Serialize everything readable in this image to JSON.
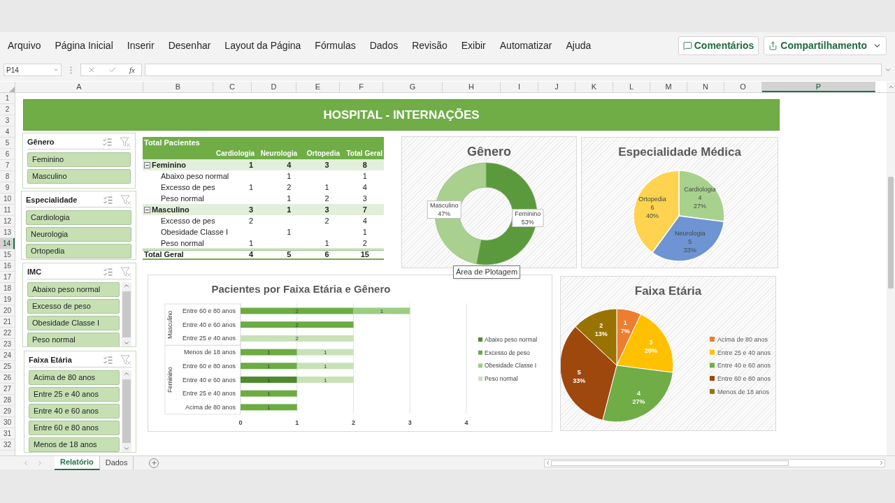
{
  "menu": [
    {
      "label": "Arquivo"
    },
    {
      "label": "Página Inicial"
    },
    {
      "label": "Inserir"
    },
    {
      "label": "Desenhar"
    },
    {
      "label": "Layout da Página"
    },
    {
      "label": "Fórmulas"
    },
    {
      "label": "Dados"
    },
    {
      "label": "Revisão"
    },
    {
      "label": "Exibir"
    },
    {
      "label": "Automatizar"
    },
    {
      "label": "Ajuda"
    }
  ],
  "actions": {
    "comments": "Comentários",
    "share": "Compartilhamento"
  },
  "formula_bar": {
    "name_box": "P14",
    "function_label": "fx"
  },
  "columns": [
    {
      "label": "A",
      "selected": false
    },
    {
      "label": "B",
      "selected": false
    },
    {
      "label": "C",
      "selected": false
    },
    {
      "label": "D",
      "selected": false
    },
    {
      "label": "E",
      "selected": false
    },
    {
      "label": "F",
      "selected": false
    },
    {
      "label": "G",
      "selected": false
    },
    {
      "label": "H",
      "selected": false
    },
    {
      "label": "I",
      "selected": false
    },
    {
      "label": "J",
      "selected": false
    },
    {
      "label": "K",
      "selected": false
    },
    {
      "label": "L",
      "selected": false
    },
    {
      "label": "M",
      "selected": false
    },
    {
      "label": "N",
      "selected": false
    },
    {
      "label": "O",
      "selected": false
    },
    {
      "label": "P",
      "selected": true
    }
  ],
  "rows": [
    {
      "label": "1",
      "selected": false
    },
    {
      "label": "2",
      "selected": false
    },
    {
      "label": "3",
      "selected": false
    },
    {
      "label": "4",
      "selected": false
    },
    {
      "label": "5",
      "selected": false
    },
    {
      "label": "6",
      "selected": false
    },
    {
      "label": "7",
      "selected": false
    },
    {
      "label": "8",
      "selected": false
    },
    {
      "label": "9",
      "selected": false
    },
    {
      "label": "10",
      "selected": false
    },
    {
      "label": "11",
      "selected": false
    },
    {
      "label": "12",
      "selected": false
    },
    {
      "label": "13",
      "selected": false
    },
    {
      "label": "14",
      "selected": true
    },
    {
      "label": "15",
      "selected": false
    },
    {
      "label": "16",
      "selected": false
    },
    {
      "label": "17",
      "selected": false
    },
    {
      "label": "18",
      "selected": false
    },
    {
      "label": "19",
      "selected": false
    },
    {
      "label": "20",
      "selected": false
    },
    {
      "label": "21",
      "selected": false
    },
    {
      "label": "22",
      "selected": false
    },
    {
      "label": "23",
      "selected": false
    },
    {
      "label": "24",
      "selected": false
    },
    {
      "label": "25",
      "selected": false
    },
    {
      "label": "26",
      "selected": false
    },
    {
      "label": "27",
      "selected": false
    },
    {
      "label": "28",
      "selected": false
    },
    {
      "label": "29",
      "selected": false
    },
    {
      "label": "30",
      "selected": false
    },
    {
      "label": "31",
      "selected": false
    },
    {
      "label": "32",
      "selected": false
    }
  ],
  "banner": "HOSPITAL - INTERNAÇÕES",
  "slicers": [
    {
      "title": "Gênero",
      "items": [
        {
          "label": "Feminino",
          "selected": true
        },
        {
          "label": "Masculino",
          "selected": true
        }
      ]
    },
    {
      "title": "Especialidade",
      "items": [
        {
          "label": "Cardiologia",
          "selected": true
        },
        {
          "label": "Neurologia",
          "selected": true
        },
        {
          "label": "Ortopedia",
          "selected": true
        }
      ]
    },
    {
      "title": "IMC",
      "items": [
        {
          "label": "Abaixo peso normal",
          "selected": true
        },
        {
          "label": "Excesso de peso",
          "selected": true
        },
        {
          "label": "Obesidade Classe I",
          "selected": true
        },
        {
          "label": "Peso normal",
          "selected": true
        }
      ]
    },
    {
      "title": "Faixa Etária",
      "items": [
        {
          "label": "Acima de 80 anos",
          "selected": true
        },
        {
          "label": "Entre 25 e 40 anos",
          "selected": true
        },
        {
          "label": "Entre 40 e 60 anos",
          "selected": true
        },
        {
          "label": "Entre 60 e 80 anos",
          "selected": true
        },
        {
          "label": "Menos de 18 anos",
          "selected": true
        }
      ]
    }
  ],
  "pivot": {
    "title": "Total Pacientes",
    "columns": [
      "Cardiologia",
      "Neurologia",
      "Ortopedia",
      "Total Geral"
    ],
    "rows": [
      {
        "kind": "group",
        "label": "Feminino",
        "expanded": true,
        "cells": [
          "1",
          "4",
          "3",
          "8"
        ]
      },
      {
        "kind": "item",
        "label": "Abaixo peso normal",
        "cells": [
          null,
          "1",
          null,
          "1"
        ]
      },
      {
        "kind": "item",
        "label": "Excesso de pes",
        "cells": [
          "1",
          "2",
          "1",
          "4"
        ]
      },
      {
        "kind": "item",
        "label": "Peso normal",
        "cells": [
          null,
          "1",
          "2",
          "3"
        ]
      },
      {
        "kind": "group",
        "label": "Masculino",
        "expanded": true,
        "cells": [
          "3",
          "1",
          "3",
          "7"
        ]
      },
      {
        "kind": "item",
        "label": "Excesso de pes",
        "cells": [
          "2",
          null,
          "2",
          "4"
        ]
      },
      {
        "kind": "item",
        "label": "Obesidade Classe I",
        "cells": [
          null,
          "1",
          null,
          "1"
        ]
      },
      {
        "kind": "item",
        "label": "Peso normal",
        "cells": [
          "1",
          null,
          "1",
          "2"
        ]
      },
      {
        "kind": "total",
        "label": "Total Geral",
        "cells": [
          "4",
          "5",
          "6",
          "15"
        ]
      }
    ]
  },
  "gender_chart": {
    "chart_data": {
      "type": "donut",
      "title": "Gênero",
      "categories": [
        "Feminino",
        "Masculino"
      ],
      "values": [
        53,
        47
      ],
      "colors": [
        "#5b9a3c",
        "#a9d08e"
      ],
      "value_labels": [
        "53%",
        "47%"
      ]
    }
  },
  "tooltip": "Área de Plotagem",
  "specialty_chart": {
    "counts": [
      "4",
      "5",
      "6"
    ],
    "chart_data": {
      "type": "pie",
      "title": "Especialidade Médica",
      "categories": [
        "Cardiologia",
        "Neurologia",
        "Ortopedia"
      ],
      "values": [
        27,
        33,
        40
      ],
      "colors": [
        "#a9d18e",
        "#6f94d4",
        "#ffd34f"
      ],
      "value_labels": [
        "27%",
        "33%",
        "40%"
      ]
    }
  },
  "age_gender_chart": {
    "groups": [
      {
        "label": "Masculino"
      },
      {
        "label": "Feminino"
      }
    ],
    "chart_data": {
      "type": "bar",
      "orientation": "horizontal",
      "stacked": true,
      "grid": true,
      "legend": "right",
      "title": "Pacientes por Faixa Etária e Gênero",
      "categories": [
        "Entre 60 e 80 anos",
        "Entre 40 e 60 anos",
        "Entre 25 e 40 anos",
        "Menos de 18 anos",
        "Entre 60 e 80 anos",
        "Entre 40 e 60 anos",
        "Entre 25 e 40 anos",
        "Acima de 80 anos"
      ],
      "xlim": [
        0,
        4
      ],
      "xticks": [
        0,
        1,
        2,
        3,
        4
      ],
      "data_labels": true,
      "series": [
        {
          "name": "Abaixo peso normal",
          "color": "#4f8a2f",
          "values": [
            null,
            null,
            null,
            null,
            null,
            1,
            null,
            null
          ]
        },
        {
          "name": "Excesso de peso",
          "color": "#6cac43",
          "values": [
            2,
            2,
            null,
            1,
            1,
            null,
            1,
            1
          ]
        },
        {
          "name": "Obesidade Classe I",
          "color": "#9ccd82",
          "values": [
            1,
            null,
            null,
            null,
            null,
            null,
            null,
            null
          ]
        },
        {
          "name": "Peso normal",
          "color": "#c8e1b7",
          "values": [
            null,
            null,
            2,
            1,
            1,
            1,
            null,
            null
          ]
        }
      ]
    }
  },
  "age_chart": {
    "counts": [
      "1",
      "3",
      "4",
      "5",
      "2"
    ],
    "chart_data": {
      "type": "pie",
      "legend": "right",
      "title": "Faixa Etária",
      "categories": [
        "Acima de 80 anos",
        "Entre 25 e 40 anos",
        "Entre 40 e 60 anos",
        "Entre 60 e 80 anos",
        "Menos de 18 anos"
      ],
      "values": [
        7,
        20,
        27,
        33,
        13
      ],
      "colors": [
        "#ed7d31",
        "#ffc000",
        "#70ad47",
        "#9e480e",
        "#997300"
      ],
      "value_labels": [
        "7%",
        "20%",
        "27%",
        "33%",
        "13%"
      ]
    }
  },
  "sheet_tabs": [
    {
      "label": "Relatório",
      "selected": true
    },
    {
      "label": "Dados",
      "selected": false
    }
  ]
}
